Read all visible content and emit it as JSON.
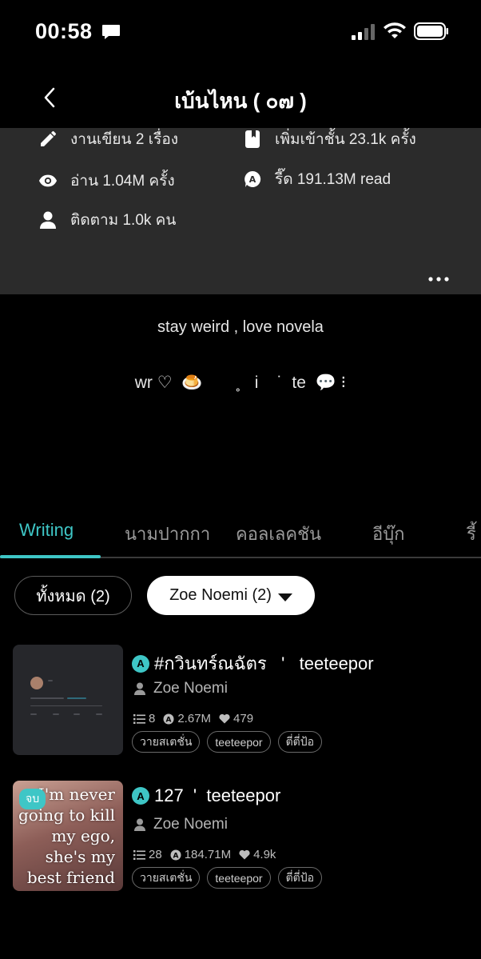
{
  "status": {
    "time": "00:58"
  },
  "header": {
    "title": "เบ้นไหน ( ๐๗ )"
  },
  "stats": {
    "works": "งานเขียน 2 เรื่อง",
    "reads": "อ่าน 1.04M ครั้ง",
    "followers": "ติดตาม 1.0k คน",
    "added_to_shelf": "เพิ่มเข้าชั้น 23.1k ครั้ง",
    "reader_reads": "รี๊ด 191.13M read"
  },
  "bio": {
    "line1": "stay weird , love novela",
    "line2": "wr ♡  🍮       ˳   i    ˙  te  💬 ⁝"
  },
  "tabs": [
    {
      "label": "Writing"
    },
    {
      "label": "นามปากกา"
    },
    {
      "label": "คอลเลคชัน"
    },
    {
      "label": "อีบุ๊ก"
    },
    {
      "label": "รี้"
    }
  ],
  "filters": {
    "all": "ทั้งหมด (2)",
    "author": "Zoe Noemi (2)"
  },
  "stories": [
    {
      "badge_letter": "A",
      "title": "#กวินทร์ณฉัตร   '   teeteepor",
      "author": "Zoe Noemi",
      "chapters": "8",
      "reads": "2.67M",
      "likes": "479",
      "tags": [
        "วายสเตชั่น",
        "teeteepor",
        "ตี่ตี่ป้อ"
      ]
    },
    {
      "badge_letter": "A",
      "title": "127  '  teeteepor",
      "author": "Zoe Noemi",
      "chapters": "28",
      "reads": "184.71M",
      "likes": "4.9k",
      "tags": [
        "วายสเตชั่น",
        "teeteepor",
        "ตี่ตี่ป้อ"
      ],
      "cover_badge": "จบ",
      "cover_text": "I'm never going to kill my ego, she's my best friend"
    }
  ],
  "colors": {
    "accent": "#3ec6c6",
    "panel": "#2b2b2b",
    "background": "#000000"
  }
}
